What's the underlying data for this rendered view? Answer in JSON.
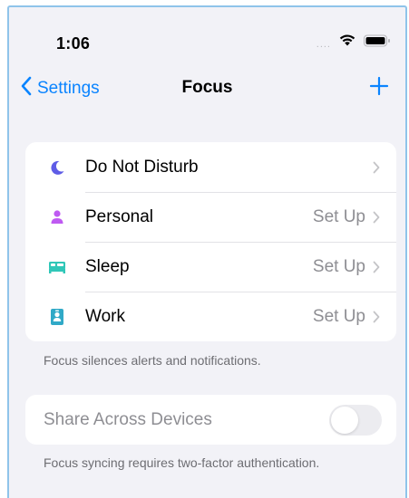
{
  "status_bar": {
    "time": "1:06",
    "signal": "....",
    "icons": [
      "wifi-icon",
      "battery-icon"
    ]
  },
  "nav": {
    "back_label": "Settings",
    "title": "Focus",
    "add_icon": "plus-icon"
  },
  "focus_modes": [
    {
      "label": "Do Not Disturb",
      "value": "",
      "icon": "moon-icon",
      "color": "#5e5ce6"
    },
    {
      "label": "Personal",
      "value": "Set Up",
      "icon": "person-icon",
      "color": "#bf5af2"
    },
    {
      "label": "Sleep",
      "value": "Set Up",
      "icon": "bed-icon",
      "color": "#30c7b8"
    },
    {
      "label": "Work",
      "value": "Set Up",
      "icon": "id-badge-icon",
      "color": "#30a9c7"
    }
  ],
  "focus_footnote": "Focus silences alerts and notifications.",
  "share": {
    "label": "Share Across Devices",
    "enabled": false,
    "footnote": "Focus syncing requires two-factor authentication."
  },
  "colors": {
    "accent": "#0a84ff",
    "background": "#f2f2f7",
    "secondary_text": "#8e8e93"
  }
}
